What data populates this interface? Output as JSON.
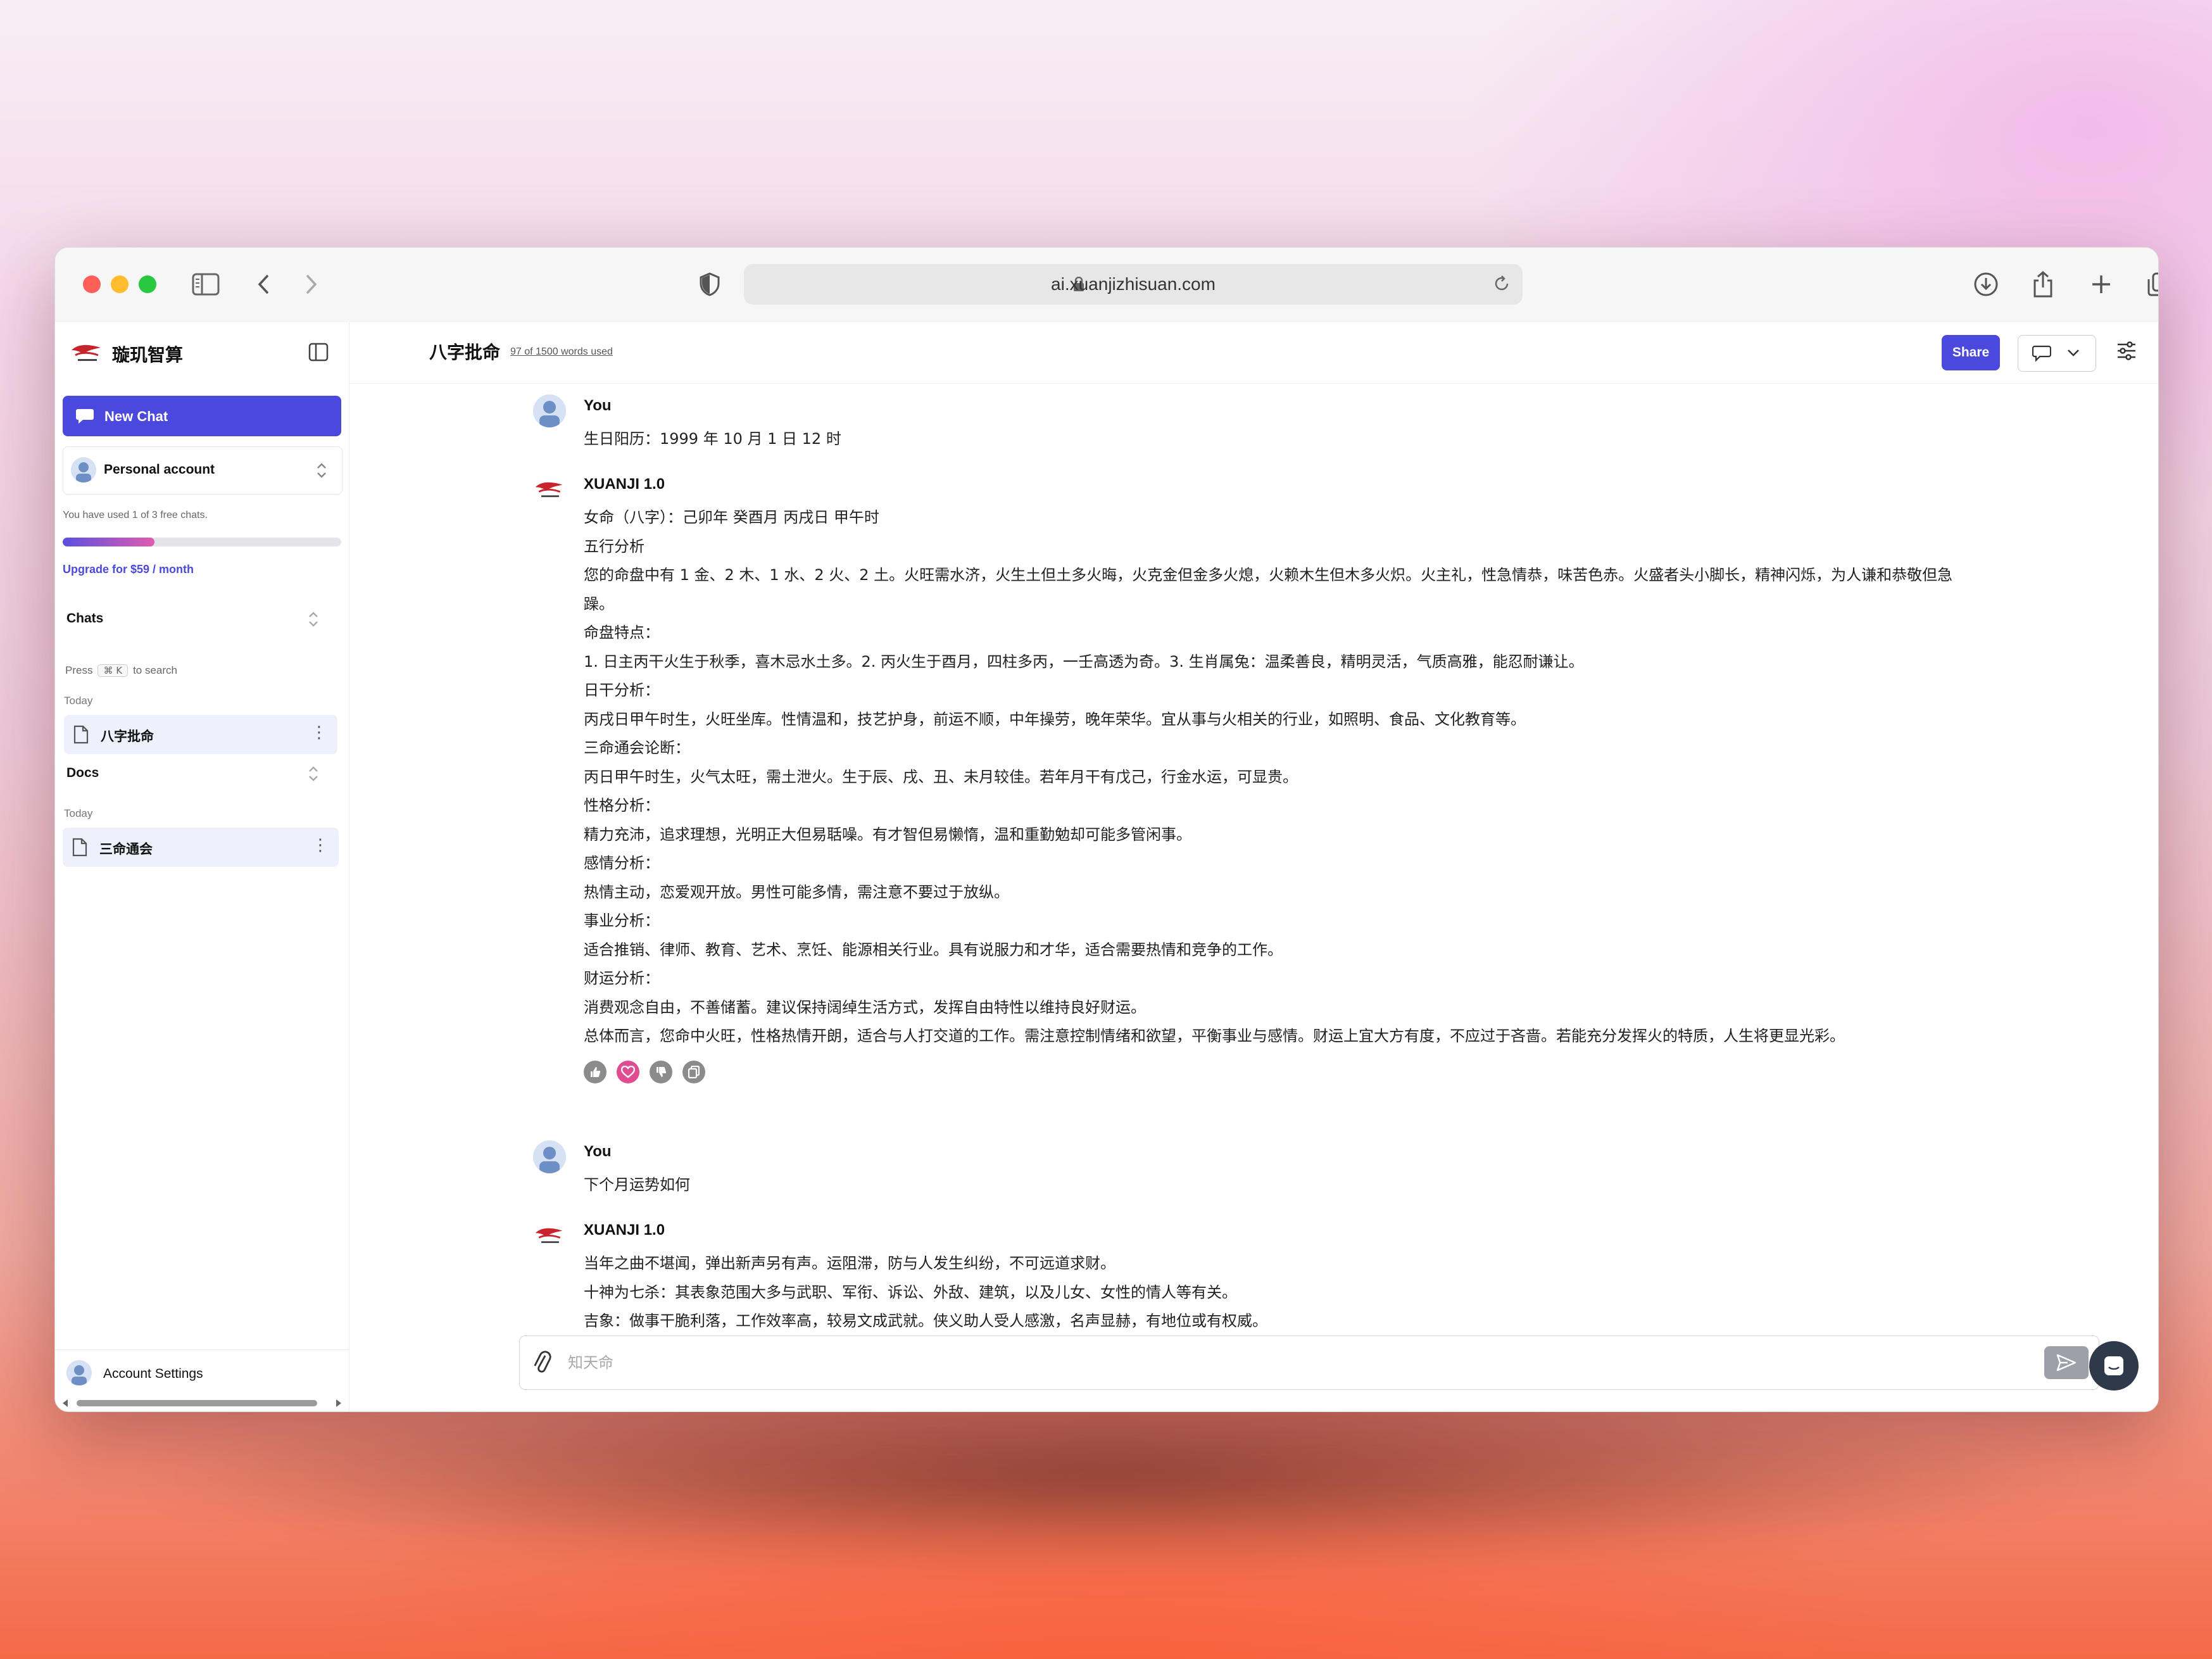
{
  "browser": {
    "url": "ai.xuanjizhisuan.com"
  },
  "sidebar": {
    "brand": "璇玑智算",
    "new_chat": "New Chat",
    "account": "Personal account",
    "usage_text": "You have used 1 of 3 free chats.",
    "usage_fraction": 0.33,
    "upgrade": "Upgrade for $59 / month",
    "chats_title": "Chats",
    "search_hint_pre": "Press",
    "search_hint_key": "⌘ K",
    "search_hint_post": "to search",
    "chats_day": "Today",
    "chat_items": [
      "八字批命"
    ],
    "docs_title": "Docs",
    "docs_day": "Today",
    "doc_items": [
      "三命通会"
    ],
    "settings": "Account Settings"
  },
  "header": {
    "title": "八字批命",
    "words_used": "97 of 1500 words used",
    "share": "Share"
  },
  "messages": [
    {
      "sender": "You",
      "lines": [
        "生日阳历：1999 年 10 月 1 日 12 时"
      ]
    },
    {
      "sender": "XUANJI 1.0",
      "lines": [
        "女命（八字）：己卯年 癸酉月 丙戌日 甲午时",
        "五行分析",
        "您的命盘中有 1 金、2 木、1 水、2 火、2 土。火旺需水济，火生土但土多火晦，火克金但金多火熄，火赖木生但木多火炽。火主礼，性急情恭，味苦色赤。火盛者头小脚长，精神闪烁，为人谦和恭敬但急",
        "躁。",
        "命盘特点：",
        "1. 日主丙干火生于秋季，喜木忌水土多。2. 丙火生于酉月，四柱多丙，一壬高透为奇。3. 生肖属兔：温柔善良，精明灵活，气质高雅，能忍耐谦让。",
        "日干分析：",
        "丙戌日甲午时生，火旺坐库。性情温和，技艺护身，前运不顺，中年操劳，晚年荣华。宜从事与火相关的行业，如照明、食品、文化教育等。",
        "三命通会论断：",
        "丙日甲午时生，火气太旺，需土泄火。生于辰、戌、丑、未月较佳。若年月干有戊己，行金水运，可显贵。",
        "性格分析：",
        "精力充沛，追求理想，光明正大但易聒噪。有才智但易懒惰，温和重勤勉却可能多管闲事。",
        "感情分析：",
        "热情主动，恋爱观开放。男性可能多情，需注意不要过于放纵。",
        "事业分析：",
        "适合推销、律师、教育、艺术、烹饪、能源相关行业。具有说服力和才华，适合需要热情和竞争的工作。",
        "财运分析：",
        "消费观念自由，不善储蓄。建议保持阔绰生活方式，发挥自由特性以维持良好财运。",
        "总体而言，您命中火旺，性格热情开朗，适合与人打交道的工作。需注意控制情绪和欲望，平衡事业与感情。财运上宜大方有度，不应过于吝啬。若能充分发挥火的特质，人生将更显光彩。"
      ]
    },
    {
      "sender": "You",
      "lines": [
        "下个月运势如何"
      ]
    },
    {
      "sender": "XUANJI 1.0",
      "lines": [
        "当年之曲不堪闻，弹出新声另有声。运阻滞，防与人发生纠纷，不可远道求财。",
        "十神为七杀：其表象范围大多与武职、军衔、诉讼、外敌、建筑，以及儿女、女性的情人等有关。",
        "吉象：做事干脆利落，工作效率高，较易文成武就。侠义助人受人感激，名声显赫，有地位或有权威。"
      ]
    }
  ],
  "reactions": [
    "thumbs-up-icon",
    "heart-icon",
    "thumbs-down-icon",
    "copy-icon"
  ],
  "composer": {
    "placeholder": "知天命"
  },
  "colors": {
    "accent": "#4b49dd",
    "heart": "#e04b92"
  }
}
